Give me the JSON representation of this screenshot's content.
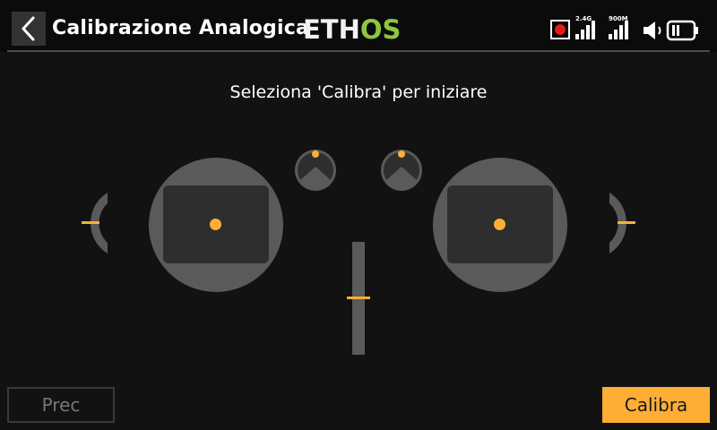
{
  "header": {
    "title": "Calibrazione Analogica",
    "logo_left": "ETH",
    "logo_right": "OS",
    "back_icon": "chevron-left-icon",
    "status": {
      "record_icon": "record-icon",
      "signal_24g_label": "2.4G",
      "signal_900m_label": "900M",
      "volume_icon": "speaker-icon",
      "battery_icon": "battery-icon"
    }
  },
  "main": {
    "instruction": "Seleziona 'Calibra' per iniziare"
  },
  "buttons": {
    "prev_label": "Prec",
    "calibrate_label": "Calibra"
  },
  "colors": {
    "accent": "#ffae35",
    "logo_green": "#8dc63f",
    "background": "#121212",
    "control_gray": "#5a5a5a",
    "record_red": "#e21b1b"
  }
}
